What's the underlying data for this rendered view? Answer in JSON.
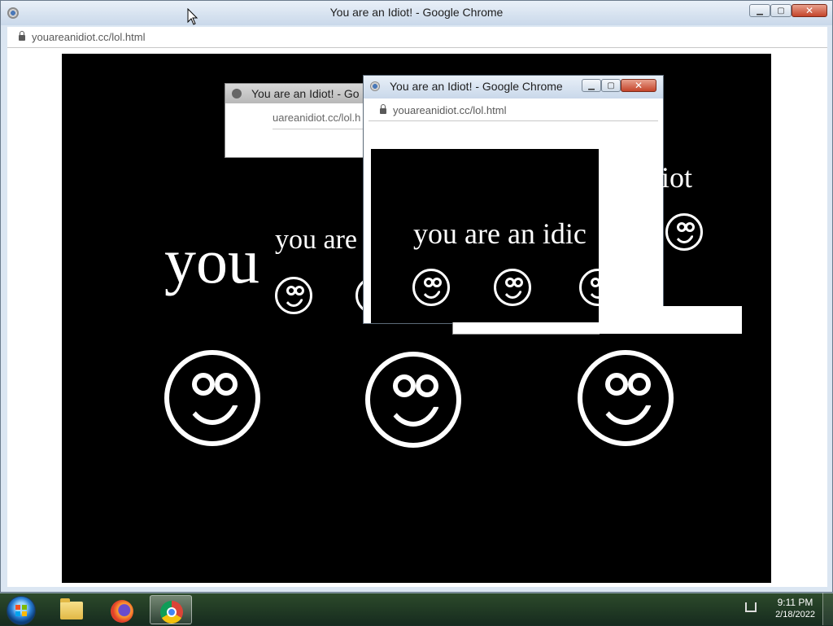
{
  "main_window": {
    "title": "You are an Idiot! - Google Chrome",
    "url": "youareanidiot.cc/lol.html",
    "page_text": "you"
  },
  "popup_back": {
    "title": "You are an Idiot! - Go",
    "url": "uareanidiot.cc/lol.h",
    "page_text": "you are"
  },
  "popup_front": {
    "title": "You are an Idiot! - Google Chrome",
    "url": "youareanidiot.cc/lol.html"
  },
  "popup_content": {
    "text_top": "an idiot",
    "text_mid": "you are an idic"
  },
  "taskbar": {
    "start": "start-orb",
    "pinned": [
      "explorer",
      "firefox",
      "chrome"
    ],
    "time": "9:11 PM",
    "date": "2/18/2022"
  },
  "colors": {
    "page_background": "#000000",
    "text": "#ffffff",
    "window_frame": "#dbe6f2"
  }
}
